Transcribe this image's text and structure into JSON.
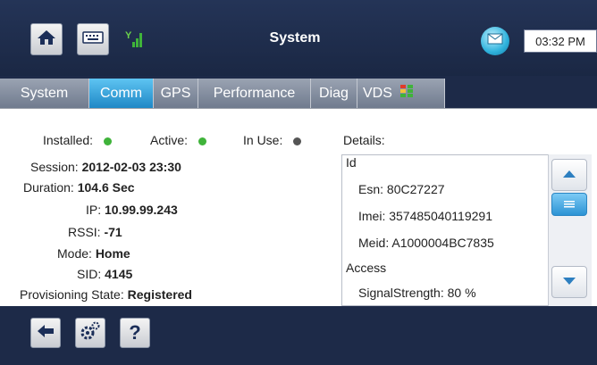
{
  "header": {
    "title": "System",
    "time": "03:32 PM",
    "icons": [
      "home-icon",
      "keyboard-icon",
      "signal-bars-icon",
      "mail-icon"
    ]
  },
  "tabs": [
    {
      "label": "System",
      "active": false
    },
    {
      "label": "Comm",
      "active": true
    },
    {
      "label": "GPS",
      "active": false
    },
    {
      "label": "Performance",
      "active": false
    },
    {
      "label": "Diag",
      "active": false
    },
    {
      "label": "VDS",
      "active": false
    }
  ],
  "status": {
    "installed_label": "Installed:",
    "active_label": "Active:",
    "inuse_label": "In Use:",
    "colors": {
      "installed": "#3fb33a",
      "active": "#3fb33a",
      "inuse": "#555555"
    }
  },
  "info": {
    "session_label": "Session:",
    "session_value": "2012-02-03 23:30",
    "duration_label": "Duration:",
    "duration_value": "104.6 Sec",
    "ip_label": "IP:",
    "ip_value": "10.99.99.243",
    "rssi_label": "RSSI:",
    "rssi_value": "-71",
    "mode_label": "Mode:",
    "mode_value": "Home",
    "sid_label": "SID:",
    "sid_value": "4145",
    "prov_label": "Provisioning State:",
    "prov_value": "Registered"
  },
  "details": {
    "label": "Details:",
    "rows": [
      "Id",
      "Esn: 80C27227",
      "Imei: 357485040119291",
      "Meid: A1000004BC7835",
      "Access",
      "SignalStrength: 80 %"
    ]
  },
  "footer": {
    "help_label": "?",
    "icons": [
      "back-arrow-icon",
      "settings-gears-icon",
      "help-icon"
    ]
  }
}
